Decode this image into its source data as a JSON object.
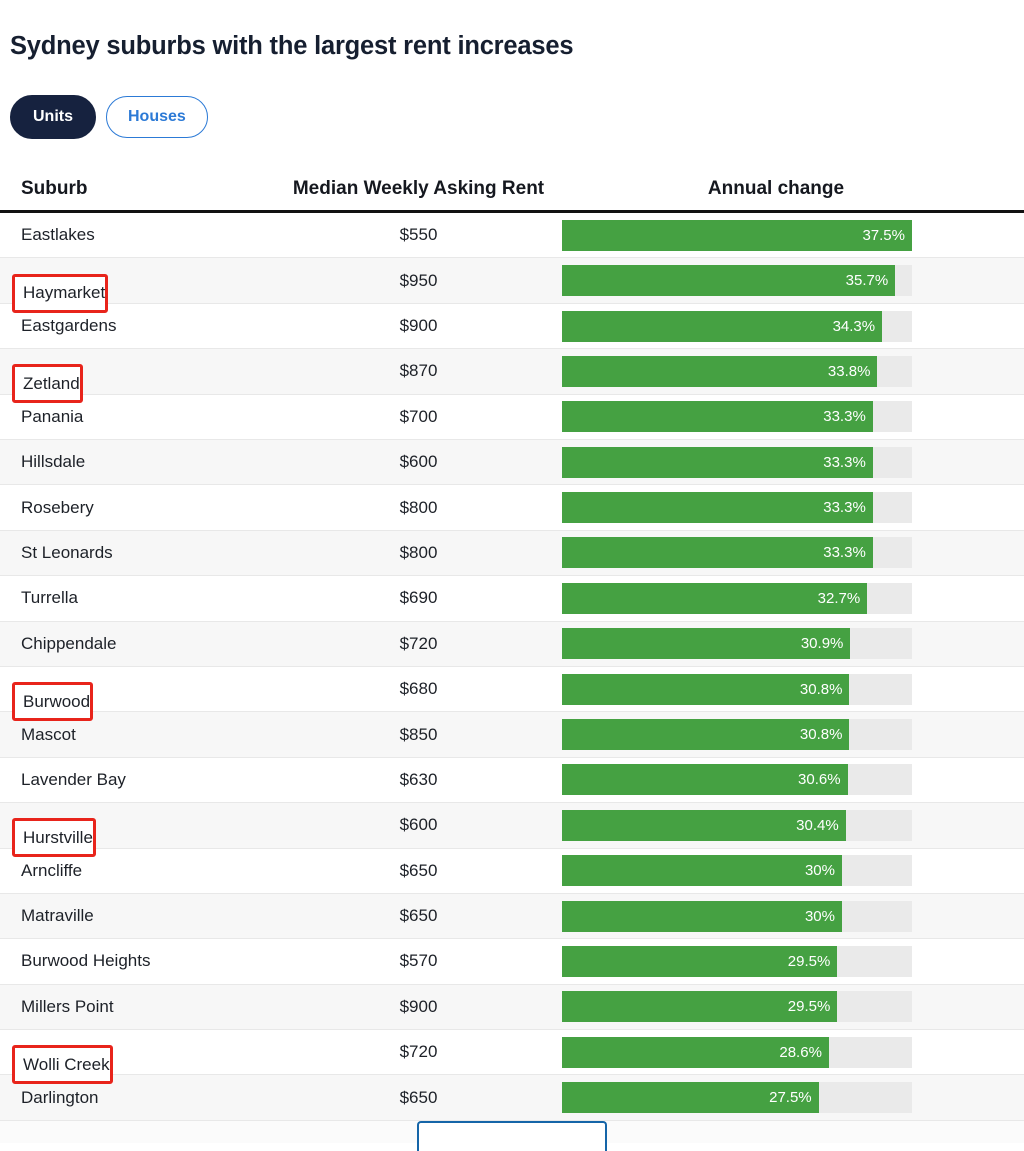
{
  "header": {
    "title": "Sydney suburbs with the largest rent increases"
  },
  "toggle": {
    "active": "Units",
    "options": [
      {
        "label": "Units",
        "selected": true
      },
      {
        "label": "Houses",
        "selected": false
      }
    ]
  },
  "colors": {
    "bar_green": "#45a142",
    "track_gray": "#eaeaea",
    "highlight_red": "#e8241b",
    "pill_active_bg": "#16223f",
    "pill_inactive_border": "#2c7ad6",
    "title": "#161f30",
    "bottom_button_border": "#1565a8"
  },
  "bottom_button": {
    "label": ""
  },
  "chart_data": {
    "type": "bar",
    "title": "Sydney suburbs with the largest rent increases",
    "subtitle": "Units",
    "xlabel": "Annual change",
    "ylabel": "Suburb",
    "orientation": "horizontal",
    "grid": false,
    "legend": "none",
    "value_suffix": "%",
    "xlim": [
      0,
      37.5
    ],
    "columns": [
      "Suburb",
      "Median Weekly Asking Rent",
      "Annual change"
    ],
    "categories": [
      "Eastlakes",
      "Haymarket",
      "Eastgardens",
      "Zetland",
      "Panania",
      "Hillsdale",
      "Rosebery",
      "St Leonards",
      "Turrella",
      "Chippendale",
      "Burwood",
      "Mascot",
      "Lavender Bay",
      "Hurstville",
      "Arncliffe",
      "Matraville",
      "Burwood Heights",
      "Millers Point",
      "Wolli Creek",
      "Darlington"
    ],
    "values": [
      37.5,
      35.7,
      34.3,
      33.8,
      33.3,
      33.3,
      33.3,
      33.3,
      32.7,
      30.9,
      30.8,
      30.8,
      30.6,
      30.4,
      30,
      30,
      29.5,
      29.5,
      28.6,
      27.5
    ],
    "rows": [
      {
        "suburb": "Eastlakes",
        "rent": "$550",
        "change": 37.5,
        "change_label": "37.5%",
        "highlighted": false
      },
      {
        "suburb": "Haymarket",
        "rent": "$950",
        "change": 35.7,
        "change_label": "35.7%",
        "highlighted": true
      },
      {
        "suburb": "Eastgardens",
        "rent": "$900",
        "change": 34.3,
        "change_label": "34.3%",
        "highlighted": false
      },
      {
        "suburb": "Zetland",
        "rent": "$870",
        "change": 33.8,
        "change_label": "33.8%",
        "highlighted": true
      },
      {
        "suburb": "Panania",
        "rent": "$700",
        "change": 33.3,
        "change_label": "33.3%",
        "highlighted": false
      },
      {
        "suburb": "Hillsdale",
        "rent": "$600",
        "change": 33.3,
        "change_label": "33.3%",
        "highlighted": false
      },
      {
        "suburb": "Rosebery",
        "rent": "$800",
        "change": 33.3,
        "change_label": "33.3%",
        "highlighted": false
      },
      {
        "suburb": "St Leonards",
        "rent": "$800",
        "change": 33.3,
        "change_label": "33.3%",
        "highlighted": false
      },
      {
        "suburb": "Turrella",
        "rent": "$690",
        "change": 32.7,
        "change_label": "32.7%",
        "highlighted": false
      },
      {
        "suburb": "Chippendale",
        "rent": "$720",
        "change": 30.9,
        "change_label": "30.9%",
        "highlighted": false
      },
      {
        "suburb": "Burwood",
        "rent": "$680",
        "change": 30.8,
        "change_label": "30.8%",
        "highlighted": true
      },
      {
        "suburb": "Mascot",
        "rent": "$850",
        "change": 30.8,
        "change_label": "30.8%",
        "highlighted": false
      },
      {
        "suburb": "Lavender Bay",
        "rent": "$630",
        "change": 30.6,
        "change_label": "30.6%",
        "highlighted": false
      },
      {
        "suburb": "Hurstville",
        "rent": "$600",
        "change": 30.4,
        "change_label": "30.4%",
        "highlighted": true
      },
      {
        "suburb": "Arncliffe",
        "rent": "$650",
        "change": 30.0,
        "change_label": "30%",
        "highlighted": false
      },
      {
        "suburb": "Matraville",
        "rent": "$650",
        "change": 30.0,
        "change_label": "30%",
        "highlighted": false
      },
      {
        "suburb": "Burwood Heights",
        "rent": "$570",
        "change": 29.5,
        "change_label": "29.5%",
        "highlighted": false
      },
      {
        "suburb": "Millers Point",
        "rent": "$900",
        "change": 29.5,
        "change_label": "29.5%",
        "highlighted": false
      },
      {
        "suburb": "Wolli Creek",
        "rent": "$720",
        "change": 28.6,
        "change_label": "28.6%",
        "highlighted": true
      },
      {
        "suburb": "Darlington",
        "rent": "$650",
        "change": 27.5,
        "change_label": "27.5%",
        "highlighted": false
      }
    ]
  }
}
